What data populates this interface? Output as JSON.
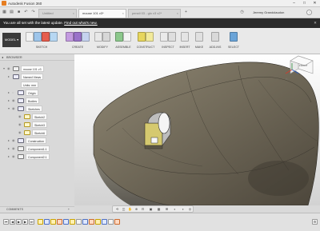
{
  "app": {
    "title": "Autodesk Fusion 360",
    "user": "Jeremy Grandclaudon"
  },
  "tabs": [
    {
      "label": "Untitled"
    },
    {
      "label": "mouse 101 v3*"
    },
    {
      "label": "pencil 03 - glo v3 v2*"
    }
  ],
  "banner": {
    "message": "You are all set with the latest update.",
    "link": "Find out what's new."
  },
  "ribbon": {
    "workspace": "MODEL",
    "groups": [
      "SKETCH",
      "CREATE",
      "MODIFY",
      "ASSEMBLE",
      "CONSTRUCT",
      "INSPECT",
      "INSERT",
      "MAKE",
      "ADD-INS",
      "SELECT"
    ]
  },
  "browser": {
    "header": "BROWSER",
    "items": [
      {
        "label": "mouse 101 v3"
      },
      {
        "label": "Named Views"
      },
      {
        "label": "Units: mm"
      },
      {
        "label": "Origin"
      },
      {
        "label": "Bodies"
      },
      {
        "label": "Sketches"
      },
      {
        "label": "Sketch2"
      },
      {
        "label": "Sketch3"
      },
      {
        "label": "Sketch6"
      },
      {
        "label": "Construction"
      },
      {
        "label": "Component1:1"
      },
      {
        "label": "Component2:1"
      }
    ]
  },
  "comments": {
    "label": "COMMENTS"
  },
  "viewcube": {
    "face": "FRONT"
  }
}
